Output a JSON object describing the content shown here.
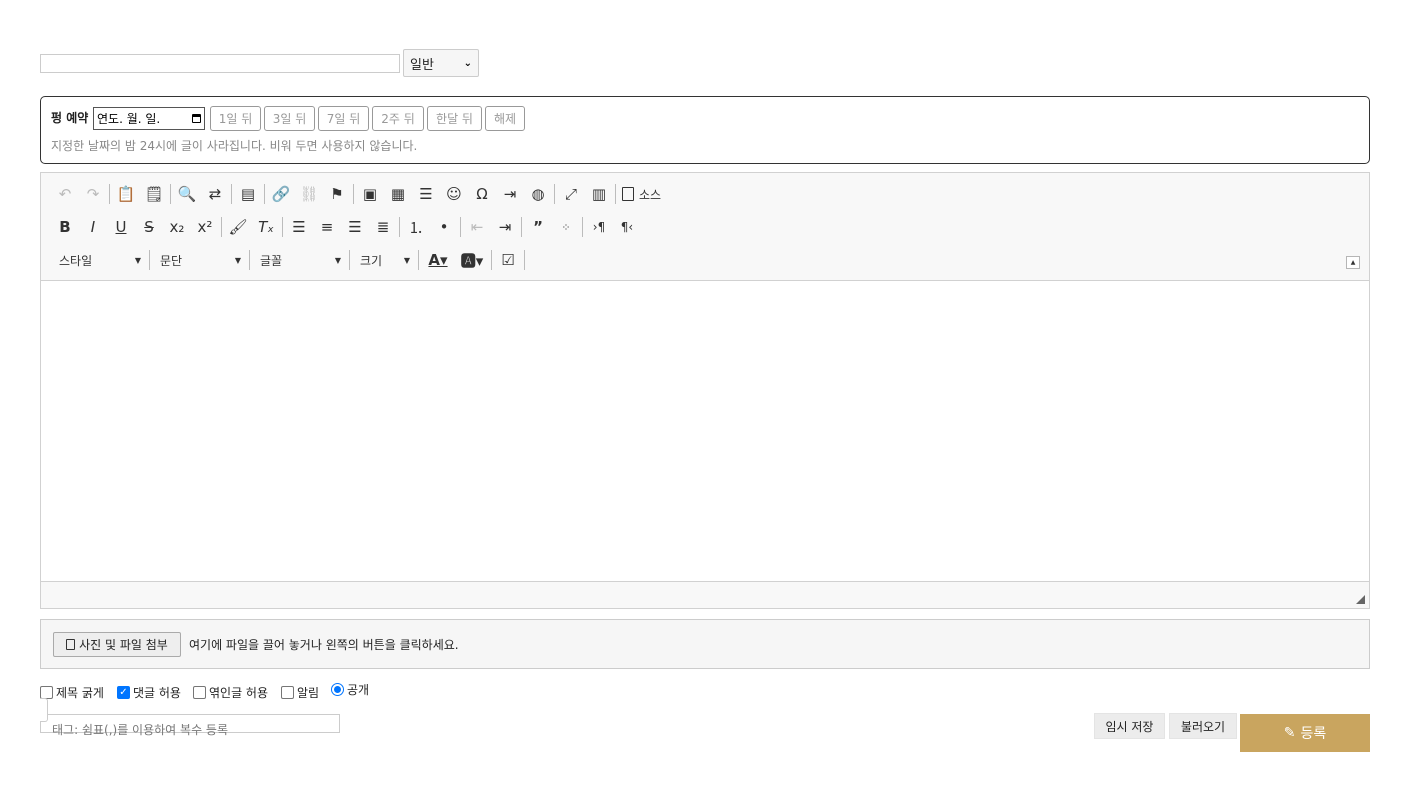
{
  "post": {
    "title_value": "",
    "category_selected": "일반"
  },
  "reservation": {
    "label": "펑 예약",
    "date_placeholder": "연도. 월. 일.",
    "quick_buttons": [
      "1일 뒤",
      "3일 뒤",
      "7일 뒤",
      "2주 뒤",
      "한달 뒤",
      "해제"
    ],
    "hint": "지정한 날짜의 밤 24시에 글이 사라집니다. 비워 두면 사용하지 않습니다."
  },
  "editor": {
    "source_label": "소스",
    "combos": {
      "style": "스타일",
      "paragraph": "문단",
      "font": "글꼴",
      "size": "크기"
    },
    "toolbar_icons": {
      "row1": [
        "undo-icon",
        "redo-icon",
        "paste-icon",
        "paste-word-icon",
        "find-icon",
        "replace-icon",
        "template-icon",
        "link-icon",
        "unlink-icon",
        "anchor-icon",
        "image-icon",
        "table-icon",
        "horizontal-line-icon",
        "smiley-icon",
        "special-char-icon",
        "page-break-icon",
        "iframe-icon",
        "maximize-icon",
        "show-blocks-icon",
        "source-icon"
      ],
      "row2": [
        "bold-icon",
        "italic-icon",
        "underline-icon",
        "strike-icon",
        "subscript-icon",
        "superscript-icon",
        "copy-format-icon",
        "remove-format-icon",
        "align-left-icon",
        "align-center-icon",
        "align-right-icon",
        "justify-icon",
        "numbered-list-icon",
        "bulleted-list-icon",
        "outdent-icon",
        "indent-icon",
        "blockquote-icon",
        "create-div-icon",
        "ltr-icon",
        "rtl-icon"
      ],
      "row3": [
        "text-color-icon",
        "bg-color-icon",
        "checkbox-icon"
      ]
    },
    "content": ""
  },
  "attach": {
    "button_label": "사진 및 파일 첨부",
    "hint": "여기에 파일을 끌어 놓거나 왼쪽의 버튼을 클릭하세요."
  },
  "options": {
    "bold_title": {
      "label": "제목 굵게",
      "checked": false
    },
    "allow_comments": {
      "label": "댓글 허용",
      "checked": true
    },
    "allow_trackback": {
      "label": "엮인글 허용",
      "checked": false
    },
    "notify": {
      "label": "알림",
      "checked": false
    },
    "public": {
      "label": "공개",
      "selected": true
    }
  },
  "tags": {
    "placeholder": "태그: 쉼표(,)를 이용하여 복수 등록"
  },
  "actions": {
    "temp_save": "임시 저장",
    "load": "불러오기",
    "submit": "등록"
  },
  "colors": {
    "submit_bg": "#c9a55f",
    "checkbox_accent": "#0075ff"
  }
}
